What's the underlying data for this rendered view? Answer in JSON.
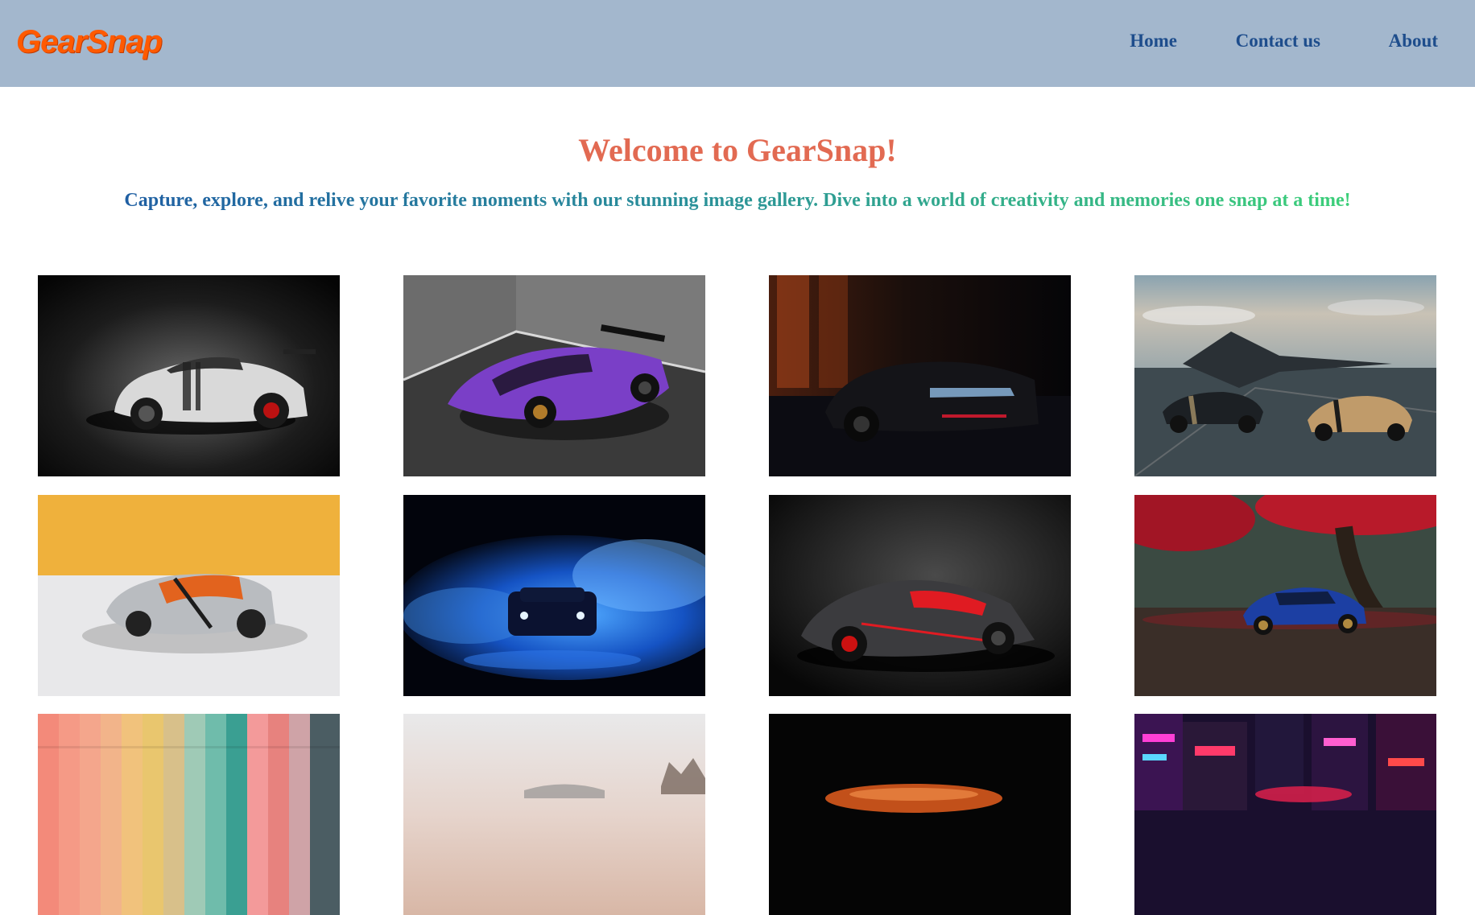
{
  "brand": {
    "name": "GearSnap",
    "color": "#ff5a00"
  },
  "nav": {
    "items": [
      {
        "label": "Home"
      },
      {
        "label": "Contact us"
      },
      {
        "label": "About"
      }
    ]
  },
  "hero": {
    "title": "Welcome to GearSnap!",
    "subtitle": "Capture, explore, and relive your favorite moments with our stunning image gallery. Dive into a world of creativity and memories one snap at a time!"
  },
  "colors": {
    "navbar": "#a3b7cd",
    "nav_link": "#1e4d8c",
    "title": "#e26a52",
    "subtitle_gradient": [
      "#1f5fa3",
      "#3ccf79"
    ]
  },
  "gallery": {
    "images": [
      {
        "subject": "white Porsche 911 GT2 RS on dark studio background"
      },
      {
        "subject": "purple Lamborghini Huracan in grey room"
      },
      {
        "subject": "black Chevrolet Camaro in dark garage"
      },
      {
        "subject": "two Bugatti Chiron cars with fighter jet on runway"
      },
      {
        "subject": "silver and orange Ford GT on yellow backdrop"
      },
      {
        "subject": "muscle car in blue smoke"
      },
      {
        "subject": "Aston Martin Valkyrie black and red"
      },
      {
        "subject": "blue Datsun 240Z under red autumn tree"
      },
      {
        "subject": "colorful pastel vertical stripes"
      },
      {
        "subject": "car against pale sky"
      },
      {
        "subject": "orange car on black background"
      },
      {
        "subject": "car on neon-lit city street at night"
      }
    ]
  }
}
